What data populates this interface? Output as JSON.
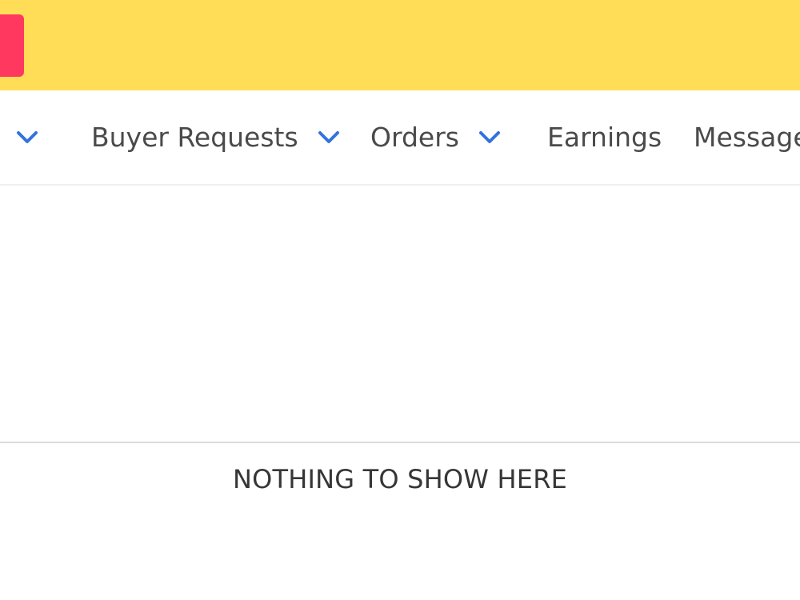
{
  "nav": {
    "items": [
      {
        "label": "",
        "has_dropdown": true
      },
      {
        "label": "Buyer Requests",
        "has_dropdown": true
      },
      {
        "label": "Orders",
        "has_dropdown": true
      },
      {
        "label": "Earnings",
        "has_dropdown": false
      },
      {
        "label": "Message",
        "has_dropdown": false
      }
    ]
  },
  "main": {
    "empty_message": "NOTHING TO SHOW HERE"
  },
  "colors": {
    "top_bar": "#ffdd57",
    "red_button": "#ff3860",
    "chevron": "#3273dc",
    "nav_text": "#4a4a4a"
  },
  "icons": {
    "chevron": "chevron-down-icon"
  }
}
